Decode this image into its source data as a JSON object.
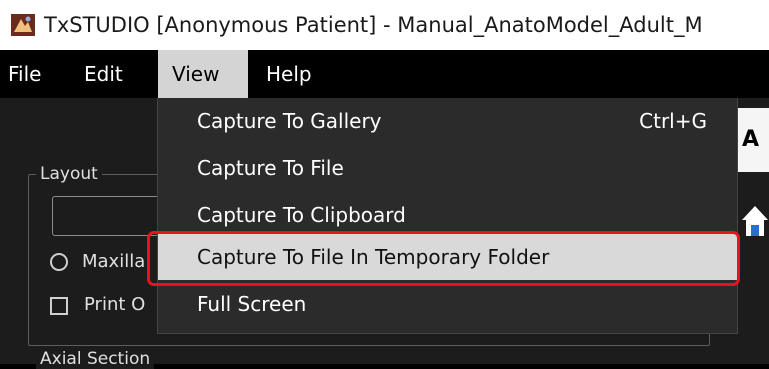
{
  "window": {
    "title": "TxSTUDIO [Anonymous Patient] - Manual_AnatoModel_Adult_M",
    "icon": "app-logo-icon"
  },
  "menubar": {
    "items": [
      "File",
      "Edit",
      "View",
      "Help"
    ],
    "active": "View"
  },
  "dropdown": {
    "items": [
      {
        "label": "Capture To Gallery",
        "shortcut": "Ctrl+G"
      },
      {
        "label": "Capture To File",
        "shortcut": ""
      },
      {
        "label": "Capture To Clipboard",
        "shortcut": ""
      },
      {
        "label": "Capture To File In Temporary Folder",
        "shortcut": ""
      },
      {
        "label": "Full Screen",
        "shortcut": ""
      }
    ],
    "highlighted_index": 3,
    "highlight_color": "#e8141c"
  },
  "panel": {
    "layout_label": "Layout",
    "maxilla_label": "Maxilla",
    "print_label": "Print O",
    "axial_label": "Axial Section"
  },
  "right": {
    "tab_text": "A",
    "home_icon": "home-icon"
  },
  "colors": {
    "menu_bg": "#000000",
    "dropdown_bg": "#2b2b2b",
    "active_bg": "#d4d4d4"
  }
}
